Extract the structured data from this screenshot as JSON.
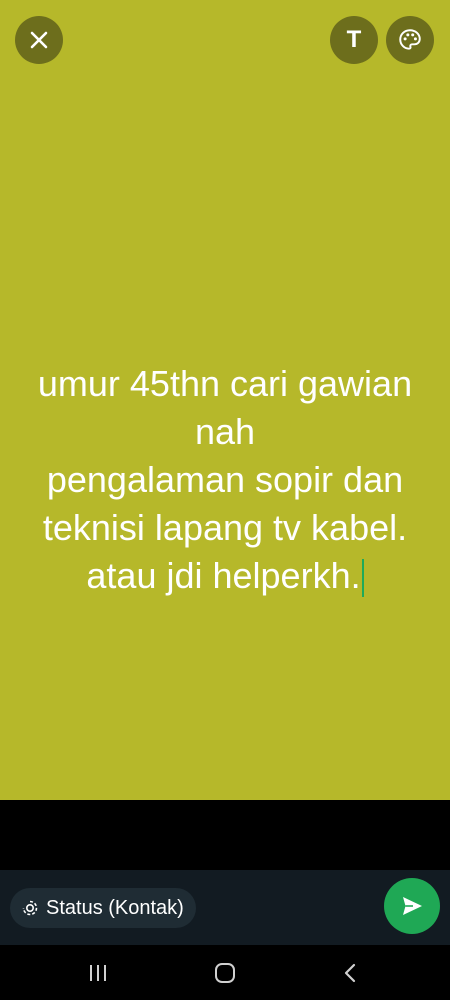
{
  "canvas": {
    "background_color": "#b6b82a",
    "status_text": "umur 45thn cari gawian\nnah\npengalaman sopir dan\nteknisi lapang tv kabel.\natau jdi helperkh."
  },
  "toolbar": {
    "close_icon": "close-icon",
    "text_button_glyph": "T",
    "palette_icon": "palette-icon"
  },
  "audience": {
    "label": "Status (Kontak)",
    "icon": "status-icon"
  },
  "send": {
    "icon": "send-icon",
    "color": "#1fa855"
  },
  "nav": {
    "recents_icon": "recents-icon",
    "home_icon": "home-icon",
    "back_icon": "back-icon"
  }
}
